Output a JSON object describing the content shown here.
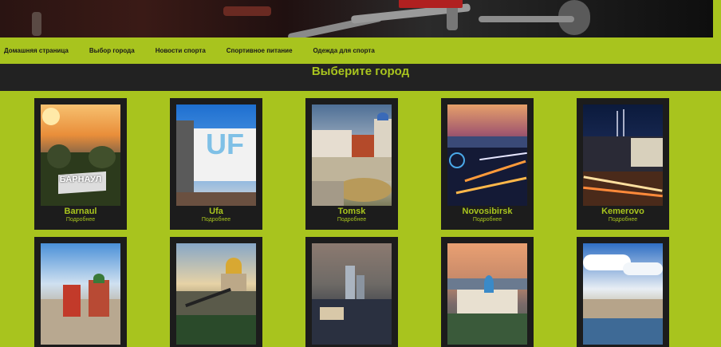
{
  "nav": {
    "items": [
      {
        "label": "Домашняя страница"
      },
      {
        "label": "Выбор города"
      },
      {
        "label": "Новости спорта"
      },
      {
        "label": "Спортивное питание"
      },
      {
        "label": "Одежда для спорта"
      }
    ]
  },
  "page": {
    "title": "Выберите город"
  },
  "cards": [
    {
      "name": "Barnaul",
      "more": "Подробнее",
      "photo_caption": "БАРНАУЛ"
    },
    {
      "name": "Ufa",
      "more": "Подробнее",
      "photo_caption": "UF"
    },
    {
      "name": "Tomsk",
      "more": "Подробнее"
    },
    {
      "name": "Novosibirsk",
      "more": "Подробнее"
    },
    {
      "name": "Kemerovo",
      "more": "Подробнее"
    }
  ],
  "colors": {
    "accent": "#a8c41e",
    "dark": "#222222",
    "card": "#1c1c1c"
  }
}
